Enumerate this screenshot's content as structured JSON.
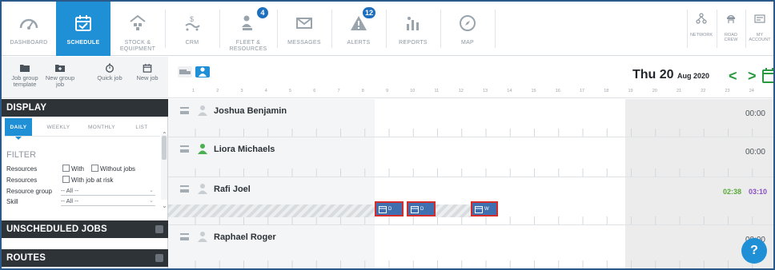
{
  "nav": {
    "items": [
      {
        "label": "DASHBOARD",
        "icon": "dashboard-gauge-icon"
      },
      {
        "label": "SCHEDULE",
        "icon": "calendar-check-icon"
      },
      {
        "label": "STOCK &\nEQUIPMENT",
        "icon": "warehouse-icon"
      },
      {
        "label": "CRM",
        "icon": "crm-money-icon"
      },
      {
        "label": "FLEET &\nRESOURCES",
        "icon": "fleet-user-icon",
        "badge": "4"
      },
      {
        "label": "MESSAGES",
        "icon": "envelope-icon"
      },
      {
        "label": "ALERTS",
        "icon": "alert-triangle-icon",
        "badge": "12"
      },
      {
        "label": "REPORTS",
        "icon": "reports-chart-icon"
      },
      {
        "label": "MAP",
        "icon": "compass-icon"
      }
    ],
    "right": [
      {
        "label": "NETWORK",
        "icon": "network-icon"
      },
      {
        "label": "ROAD\nCREW",
        "icon": "road-crew-icon"
      },
      {
        "label": "MY\nACCOUNT",
        "icon": "account-icon"
      }
    ]
  },
  "toolbar": {
    "buttons": [
      {
        "label": "Job group\ntemplate",
        "icon": "folder-icon"
      },
      {
        "label": "New group\njob",
        "icon": "folder-add-icon"
      },
      {
        "label": "Quick job",
        "icon": "stopwatch-icon"
      },
      {
        "label": "New job",
        "icon": "calendar-icon"
      }
    ]
  },
  "sidebar": {
    "display_title": "DISPLAY",
    "tabs": [
      "DAILY",
      "WEEKLY",
      "MONTHLY",
      "LIST"
    ],
    "active_tab": "DAILY",
    "filter_title": "FILTER",
    "filters": {
      "resources_label": "Resources",
      "with_label": "With",
      "without_label": "Without jobs",
      "at_risk_label": "With job at risk",
      "resource_group_label": "Resource group",
      "resource_group_value": "-- All --",
      "skill_label": "Skill",
      "skill_value": "-- All --"
    },
    "unscheduled_title": "UNSCHEDULED JOBS",
    "routes_title": "ROUTES"
  },
  "schedule": {
    "date_main": "Thu 20",
    "date_small": "Aug 2020",
    "hours": [
      "1",
      "2",
      "3",
      "4",
      "5",
      "6",
      "7",
      "8",
      "9",
      "10",
      "11",
      "12",
      "13",
      "14",
      "15",
      "16",
      "17",
      "18",
      "19",
      "20",
      "21",
      "22",
      "23",
      "24"
    ],
    "rows": [
      {
        "name": "Joshua Benjamin",
        "time": "00:00",
        "online": false
      },
      {
        "name": "Liora Michaels",
        "time": "00:00",
        "online": true
      },
      {
        "name": "Rafi Joel",
        "time_a": "02:38",
        "time_b": "03:10",
        "online": false,
        "jobs": [
          {
            "label": "D"
          },
          {
            "label": "D"
          },
          {
            "label": "W"
          }
        ]
      },
      {
        "name": "Raphael Roger",
        "time": "00:00",
        "online": false
      }
    ]
  },
  "colors": {
    "accent": "#1f8fd6",
    "dark": "#2e3338",
    "online": "#4caf50",
    "time_green": "#5aa83a",
    "time_purple": "#8a4fc4",
    "job_border": "#d62b2b"
  },
  "help": {
    "label": "?"
  }
}
